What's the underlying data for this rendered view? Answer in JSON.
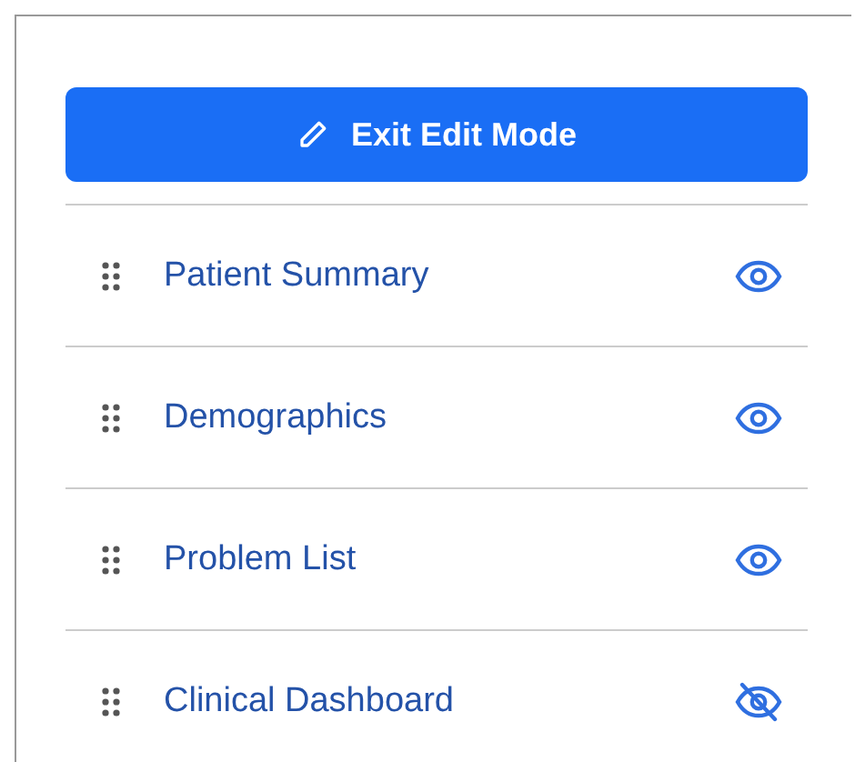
{
  "edit_button": {
    "label": "Exit Edit Mode"
  },
  "sections": [
    {
      "label": "Patient Summary",
      "visible": true
    },
    {
      "label": "Demographics",
      "visible": true
    },
    {
      "label": "Problem List",
      "visible": true
    },
    {
      "label": "Clinical Dashboard",
      "visible": false
    }
  ]
}
